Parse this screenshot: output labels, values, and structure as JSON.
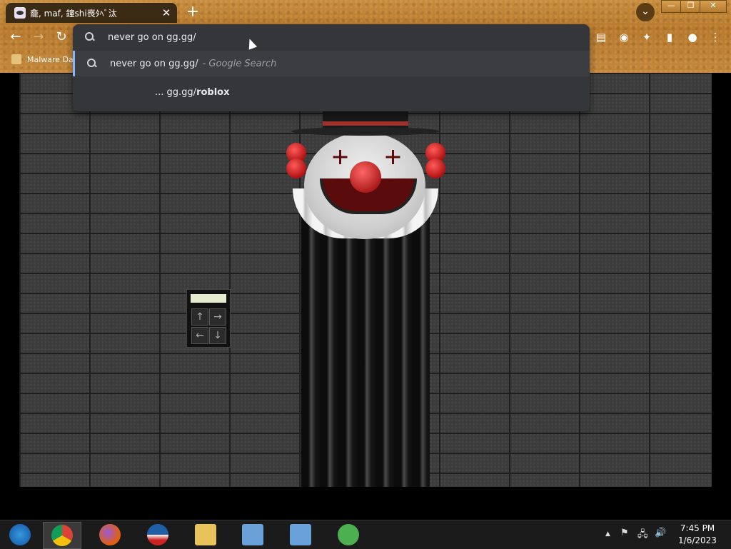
{
  "browser": {
    "tab": {
      "title": "龕, maf, 鐘shi喪ﾀﾍﾞ汰",
      "close": "✕"
    },
    "new_tab": "+",
    "tab_search": "⌄",
    "window_controls": {
      "minimize": "—",
      "maximize": "❐",
      "close": "✕"
    },
    "nav": {
      "back": "←",
      "forward": "→",
      "reload": "↻"
    },
    "bookmarks": [
      {
        "label": "Malware Dat"
      }
    ],
    "extensions": [
      {
        "icon": "tabs-icon"
      },
      {
        "icon": "profile-avatar-icon"
      },
      {
        "icon": "puzzle-icon"
      },
      {
        "icon": "side-panel-icon"
      },
      {
        "icon": "account-icon"
      },
      {
        "icon": "more-vert-icon"
      }
    ]
  },
  "omnibox": {
    "input_text": "never go on gg.gg/",
    "suggestions": [
      {
        "text": "never go on gg.gg/",
        "suffix": "- Google Search"
      },
      {
        "prefix": "... gg.gg/",
        "bold": "roblox"
      }
    ]
  },
  "page": {
    "keypad_keys": [
      "↑",
      "→",
      "←",
      "↓"
    ]
  },
  "taskbar": {
    "apps": [
      "start-orb-icon",
      "chrome-icon",
      "firefox-icon",
      "obama-logo-icon",
      "file-explorer-icon",
      "network-setup-icon",
      "network-setup-icon-2",
      "messenger-icon"
    ],
    "tray": {
      "up_arrow": "▲",
      "flag": "⚑",
      "network": "🖧",
      "volume": "🔊"
    },
    "clock": {
      "time": "7:45 PM",
      "date": "1/6/2023"
    }
  }
}
